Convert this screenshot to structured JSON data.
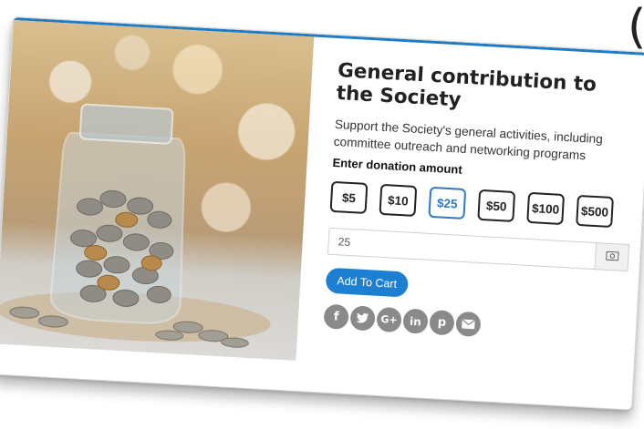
{
  "page": {
    "cut_glyph": "("
  },
  "product": {
    "title": "General contribution to the Society",
    "description": "Support the Society's general activities, including committee outreach and networking programs",
    "amount_label": "Enter donation amount",
    "amount_options": [
      "$5",
      "$10",
      "$25",
      "$50",
      "$100",
      "$500"
    ],
    "selected_amount": "$25",
    "amount_value": "25",
    "add_to_cart_label": "Add To Cart"
  },
  "share": {
    "icons": [
      {
        "name": "facebook-icon",
        "glyph": "f"
      },
      {
        "name": "twitter-icon",
        "glyph": "t"
      },
      {
        "name": "google-plus-icon",
        "glyph": "G+"
      },
      {
        "name": "linkedin-icon",
        "glyph": "in"
      },
      {
        "name": "pinterest-icon",
        "glyph": "p"
      },
      {
        "name": "email-icon",
        "glyph": ""
      }
    ]
  },
  "colors": {
    "accent": "#1d7fd2",
    "selected": "#2b79c0",
    "icon_gray": "#8a8a8a",
    "text": "#222222"
  }
}
